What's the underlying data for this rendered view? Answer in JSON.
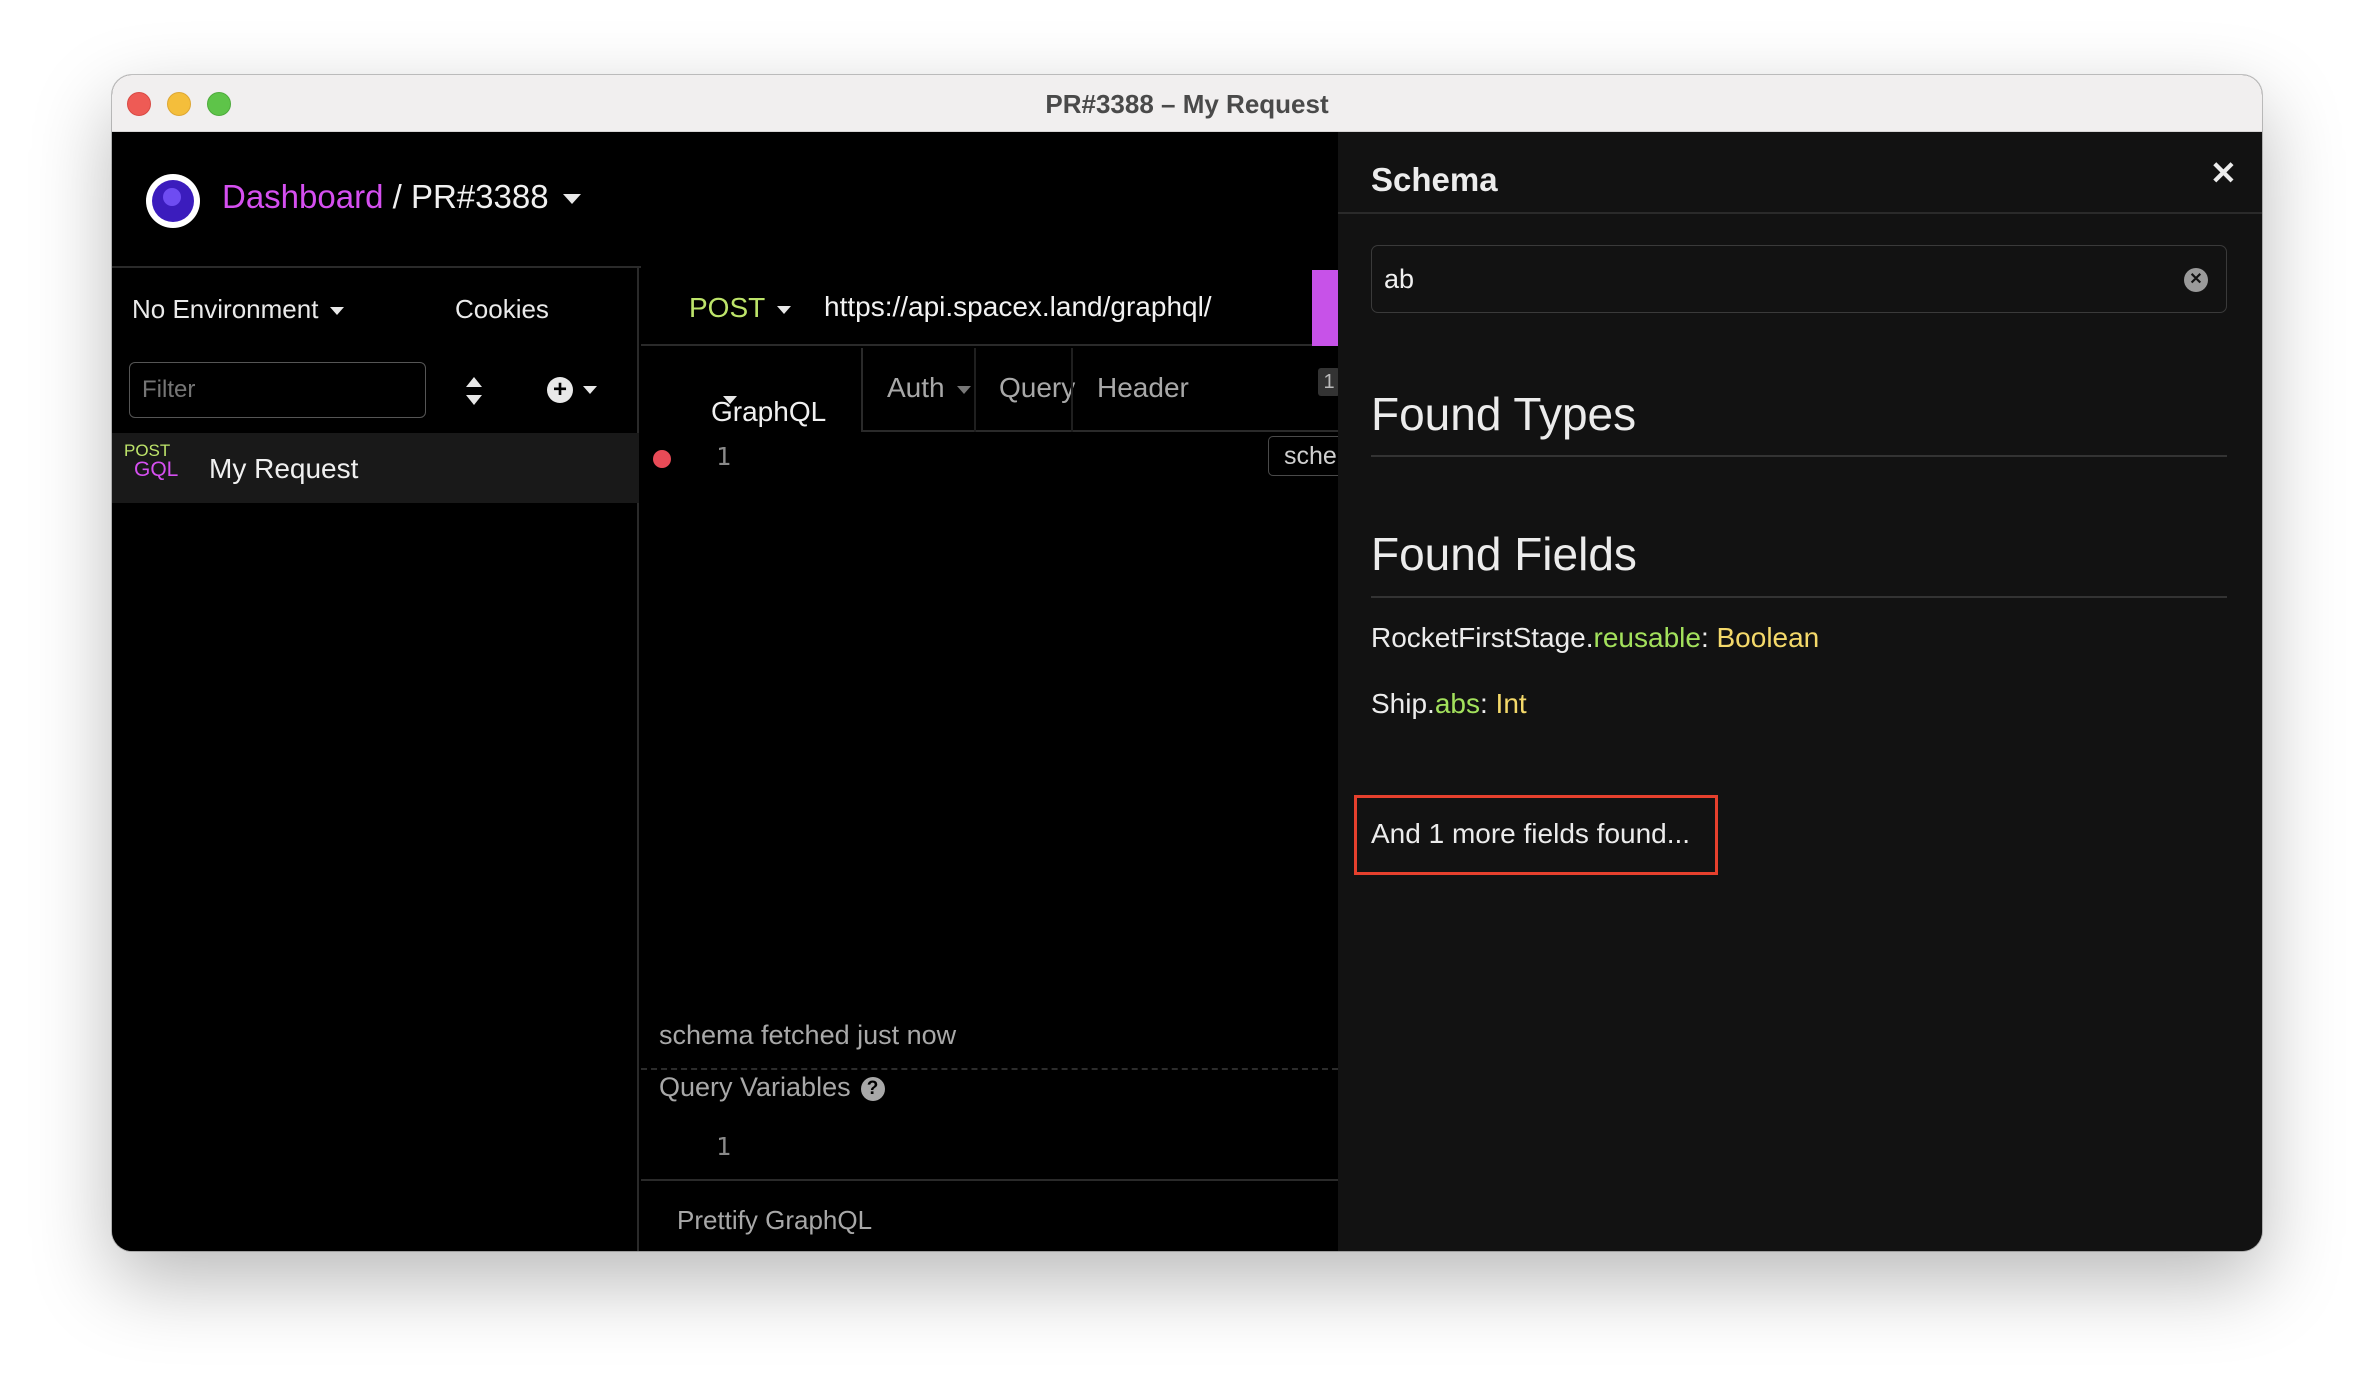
{
  "window": {
    "title": "PR#3388 – My Request"
  },
  "header": {
    "dashboard": "Dashboard",
    "separator": "/",
    "project": "PR#3388"
  },
  "sidebar": {
    "environment": "No Environment",
    "cookies": "Cookies",
    "filter_placeholder": "Filter",
    "requests": [
      {
        "method": "POST",
        "type": "GQL",
        "name": "My Request"
      }
    ]
  },
  "request": {
    "method": "POST",
    "url": "https://api.spacex.land/graphql/",
    "tabs": [
      "GraphQL",
      "Auth",
      "Query",
      "Header"
    ],
    "header_count": "1",
    "editor": {
      "line_number": "1",
      "schema_button": "schema"
    },
    "status": "schema fetched just now",
    "query_variables": {
      "label": "Query Variables",
      "line_number": "1"
    },
    "prettify": "Prettify GraphQL"
  },
  "schema": {
    "title": "Schema",
    "search_value": "ab",
    "found_types": "Found Types",
    "found_fields": "Found Fields",
    "fields": [
      {
        "type": "RocketFirstStage",
        "field": "reusable",
        "return_type": "Boolean"
      },
      {
        "type": "Ship",
        "field": "abs",
        "return_type": "Int"
      }
    ],
    "more": "And 1 more fields found..."
  },
  "colors": {
    "accent": "#d54ff0",
    "method": "#bde46a",
    "field_name": "#a3e15c",
    "field_type": "#f4d96a",
    "highlight_box": "#e5402d"
  }
}
